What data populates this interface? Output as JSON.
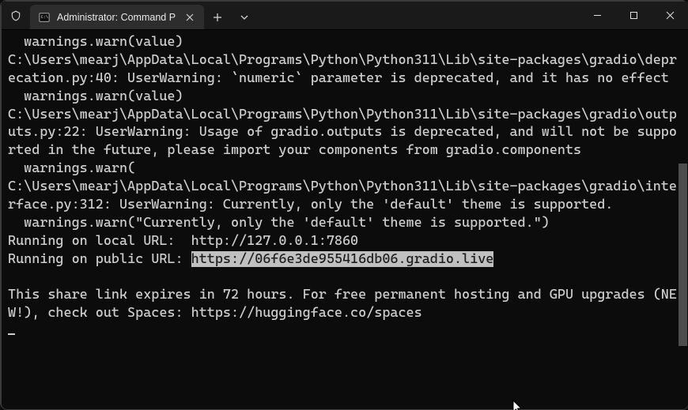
{
  "window": {
    "tab_title": "Administrator: Command Pro",
    "new_tab_tooltip": "+",
    "dropdown_glyph": "⌄"
  },
  "terminal": {
    "lines": [
      "  warnings.warn(value)",
      "C:\\Users\\mearj\\AppData\\Local\\Programs\\Python\\Python311\\Lib\\site-packages\\gradio\\deprecation.py:40: UserWarning: `numeric` parameter is deprecated, and it has no effect",
      "  warnings.warn(value)",
      "C:\\Users\\mearj\\AppData\\Local\\Programs\\Python\\Python311\\Lib\\site-packages\\gradio\\outputs.py:22: UserWarning: Usage of gradio.outputs is deprecated, and will not be supported in the future, please import your components from gradio.components",
      "  warnings.warn(",
      "C:\\Users\\mearj\\AppData\\Local\\Programs\\Python\\Python311\\Lib\\site-packages\\gradio\\interface.py:312: UserWarning: Currently, only the 'default' theme is supported.",
      "  warnings.warn(\"Currently, only the 'default' theme is supported.\")",
      "Running on local URL:  http://127.0.0.1:7860"
    ],
    "public_line_prefix": "Running on public URL: ",
    "public_url": "https://06f6e3de955416db06.gradio.live",
    "blank": "",
    "footer": "This share link expires in 72 hours. For free permanent hosting and GPU upgrades (NEW!), check out Spaces: https://huggingface.co/spaces"
  },
  "scrollbar": {
    "thumb_top_pct": 35,
    "thumb_height_pct": 48
  }
}
